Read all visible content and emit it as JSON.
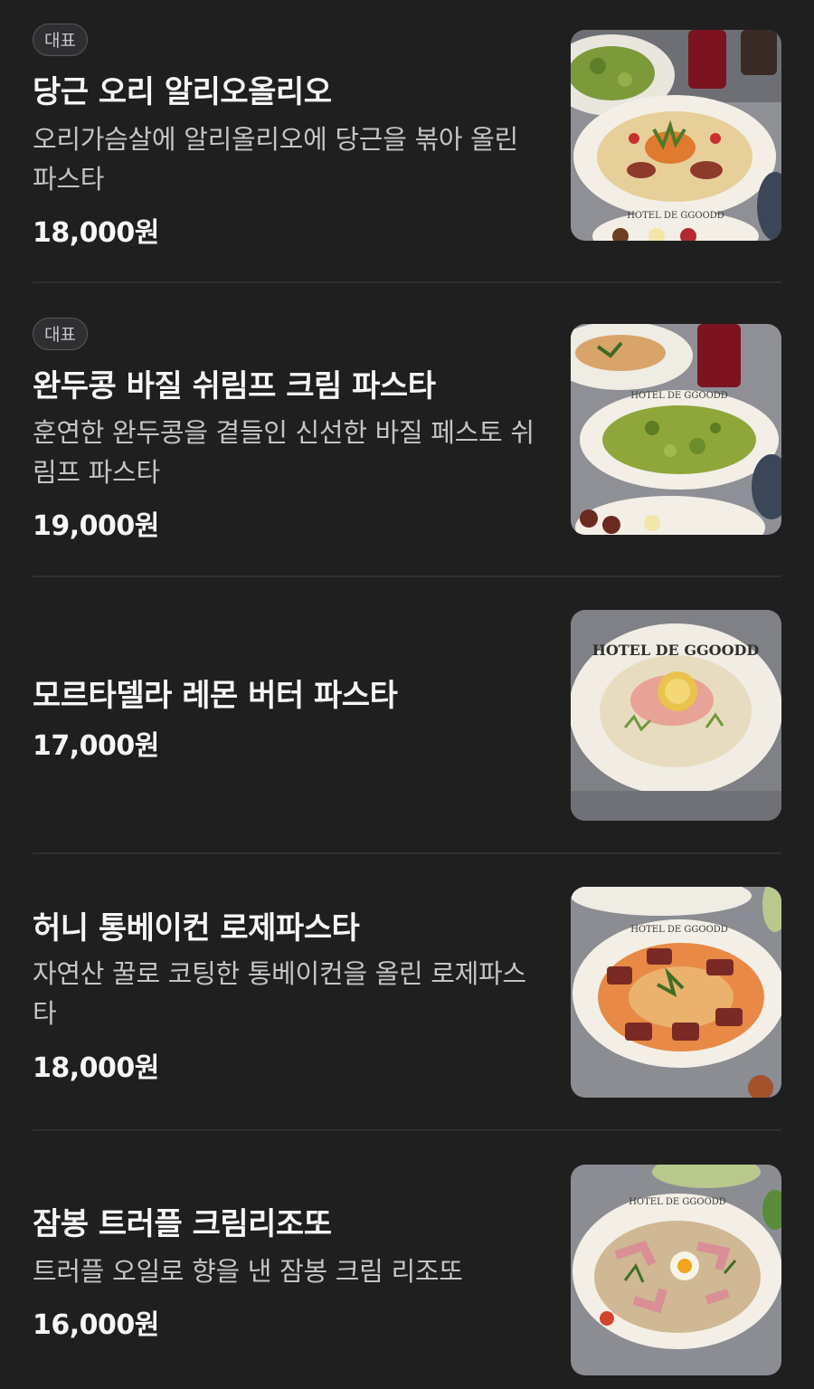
{
  "menu": {
    "items": [
      {
        "badge": "대표",
        "name": "당근 오리 알리오올리오",
        "description": "오리가슴살에 알리올리오에 당근을 볶아 올린 파스타",
        "price": "18,000원",
        "photo_label": "HOTEL DE GGOODD"
      },
      {
        "badge": "대표",
        "name": "완두콩 바질 쉬림프 크림 파스타",
        "description": "훈연한 완두콩을 곁들인 신선한 바질 페스토 쉬림프 파스타",
        "price": "19,000원",
        "photo_label": "HOTEL DE GGOODD"
      },
      {
        "name": "모르타델라 레몬 버터 파스타",
        "price": "17,000원",
        "photo_label": "HOTEL DE GGOODD"
      },
      {
        "name": "허니 통베이컨 로제파스타",
        "description": "자연산 꿀로 코팅한 통베이컨을 올린 로제파스타",
        "price": "18,000원",
        "photo_label": "HOTEL DE GGOODD"
      },
      {
        "name": "잠봉 트러플 크림리조또",
        "description": "트러플 오일로 향을 낸 잠봉 크림 리조또",
        "price": "16,000원",
        "photo_label": "HOTEL DE GGOODD"
      }
    ]
  }
}
